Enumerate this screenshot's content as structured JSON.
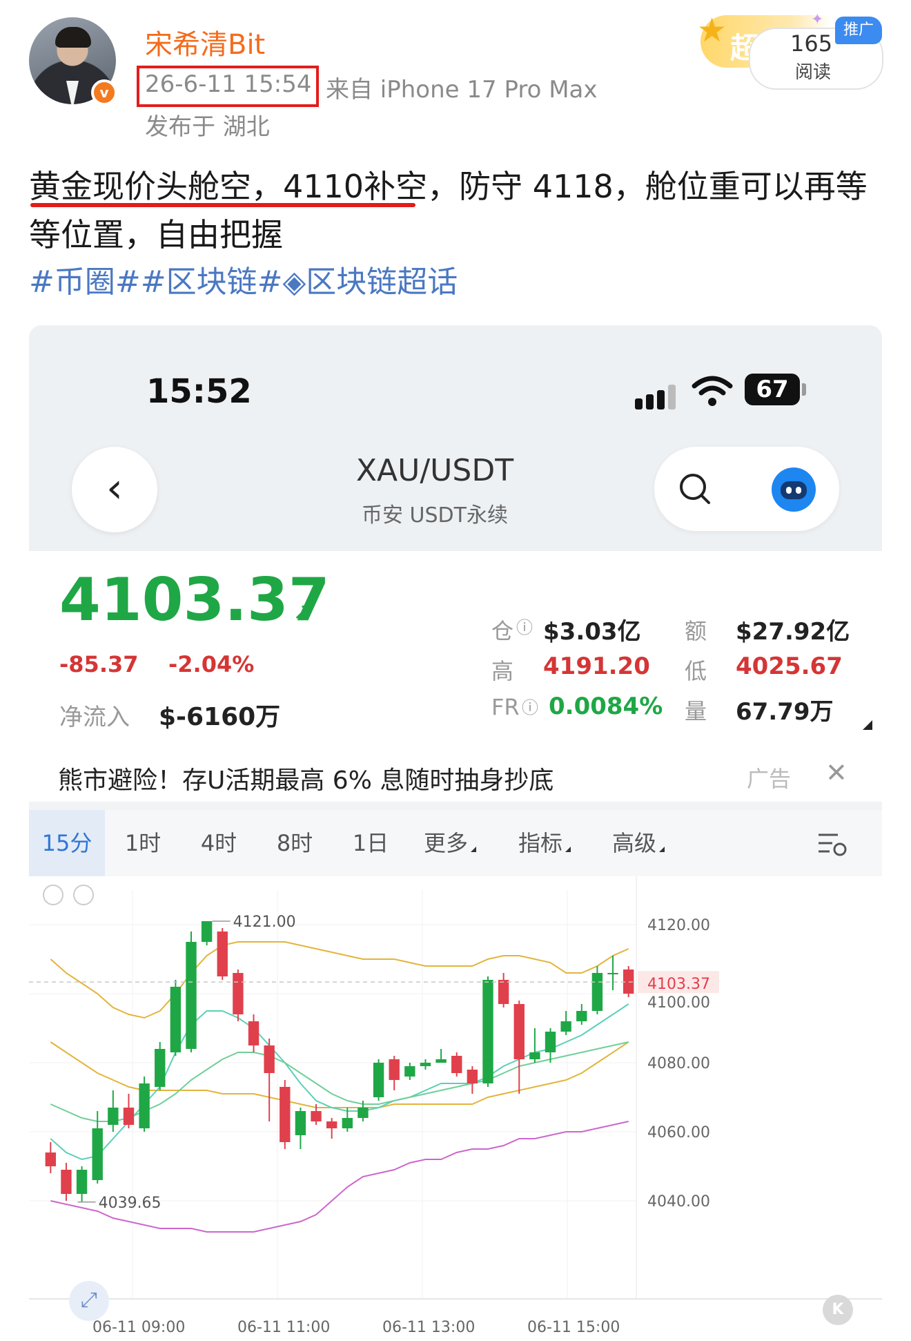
{
  "post": {
    "username": "宋希清Bit",
    "verified_mark": "v",
    "time": "26-6-11 15:54",
    "source": "来自 iPhone 17 Pro Max",
    "location": "发布于 湖北",
    "body": "黄金现价头舱空，4110补空，防守 4118，舱位重可以再等等位置，自由把握",
    "hashtags": "#币圈##区块链#◈区块链超话",
    "promo": {
      "badge": "超",
      "reads": "165",
      "reads_label": "阅读",
      "tag": "推广"
    }
  },
  "screenshot": {
    "status_bar": {
      "time": "15:52",
      "battery": "67"
    },
    "header": {
      "back_icon": "‹",
      "pair": "XAU/USDT",
      "subtitle": "币安 USDT永续"
    },
    "ticker": {
      "price": "4103.37",
      "change_abs": "-85.37",
      "change_pct": "-2.04%",
      "netflow_label": "净流入",
      "netflow": "$-6160万",
      "stats": {
        "oi_label": "仓",
        "oi": "$3.03亿",
        "turnover_label": "额",
        "turnover": "$27.92亿",
        "high_label": "高",
        "high": "4191.20",
        "low_label": "低",
        "low": "4025.67",
        "fr_label": "FR",
        "fr": "0.0084%",
        "volume_label": "量",
        "volume": "67.79万"
      }
    },
    "ad": {
      "text": "熊市避险！存U活期最高 6% 息随时抽身抄底",
      "label": "广告",
      "close": "✕"
    },
    "tabs": [
      {
        "label": "15分"
      },
      {
        "label": "1时"
      },
      {
        "label": "4时"
      },
      {
        "label": "8时"
      },
      {
        "label": "1日"
      },
      {
        "label": "更多"
      },
      {
        "label": "指标"
      },
      {
        "label": "高级"
      }
    ]
  },
  "colors": {
    "up": "#1fa746",
    "down": "#e0404c",
    "accent": "#2f76d6",
    "username": "#f46c1c",
    "hashtag": "#4a78c2"
  },
  "chart_data": {
    "type": "candlestick",
    "interval": "15分",
    "ylim": [
      4030,
      4130
    ],
    "y_ticks": [
      "4120.00",
      "4100.00",
      "4080.00",
      "4060.00",
      "4040.00"
    ],
    "x_ticks": [
      "06-11 09:00",
      "06-11 11:00",
      "06-11 13:00",
      "06-11 15:00"
    ],
    "last_price_label": "4103.37",
    "last_price": 4103.37,
    "max_label": "4121.00",
    "min_label": "4039.65",
    "candles": [
      [
        4054,
        4050,
        4057,
        4048
      ],
      [
        4049,
        4042,
        4051,
        4040
      ],
      [
        4042,
        4049,
        4050,
        4039.65
      ],
      [
        4046,
        4061,
        4066,
        4045
      ],
      [
        4062,
        4067,
        4072,
        4060
      ],
      [
        4067,
        4062,
        4071,
        4061
      ],
      [
        4061,
        4074,
        4076,
        4060
      ],
      [
        4073,
        4084,
        4086,
        4072
      ],
      [
        4083,
        4102,
        4104,
        4082
      ],
      [
        4084,
        4115,
        4118,
        4083
      ],
      [
        4115,
        4121,
        4121,
        4114
      ],
      [
        4118,
        4105,
        4119,
        4104
      ],
      [
        4106,
        4094,
        4107,
        4092
      ],
      [
        4092,
        4085,
        4094,
        4083
      ],
      [
        4085,
        4077,
        4087,
        4063
      ],
      [
        4073,
        4057,
        4075,
        4055
      ],
      [
        4059,
        4066,
        4067,
        4055
      ],
      [
        4066,
        4063,
        4068,
        4062
      ],
      [
        4063,
        4061,
        4064,
        4058
      ],
      [
        4061,
        4064,
        4067,
        4060
      ],
      [
        4064,
        4067,
        4069,
        4063
      ],
      [
        4070,
        4080,
        4081,
        4069
      ],
      [
        4081,
        4075,
        4082,
        4072
      ],
      [
        4076,
        4079,
        4080,
        4075
      ],
      [
        4079,
        4080,
        4081,
        4078
      ],
      [
        4080,
        4081,
        4084,
        4080
      ],
      [
        4082,
        4077,
        4083,
        4076
      ],
      [
        4078,
        4074,
        4079,
        4071
      ],
      [
        4074,
        4104,
        4105,
        4073
      ],
      [
        4104,
        4097,
        4106,
        4096
      ],
      [
        4097,
        4081,
        4098,
        4071
      ],
      [
        4081,
        4083,
        4090,
        4080
      ],
      [
        4083,
        4089,
        4090,
        4080
      ],
      [
        4089,
        4092,
        4095,
        4088
      ],
      [
        4092,
        4095,
        4097,
        4091
      ],
      [
        4095,
        4106,
        4108,
        4094
      ],
      [
        4106,
        4106,
        4111,
        4101
      ],
      [
        4107,
        4100,
        4108,
        4099
      ]
    ],
    "series": [
      {
        "color": "#e3b43a",
        "values": [
          4110,
          4106,
          4103,
          4100,
          4096,
          4094,
          4093,
          4095,
          4100,
          4106,
          4111,
          4114,
          4115,
          4115,
          4115,
          4115,
          4114,
          4113,
          4112,
          4111,
          4110,
          4110,
          4110,
          4109,
          4108,
          4108,
          4108,
          4108,
          4110,
          4111,
          4111,
          4110,
          4109,
          4106,
          4106,
          4108,
          4111,
          4113
        ]
      },
      {
        "color": "#e3b43a",
        "values": [
          4086,
          4083,
          4080,
          4077,
          4075,
          4073,
          4072,
          4072,
          4072,
          4072,
          4072,
          4071,
          4071,
          4071,
          4070,
          4069,
          4068,
          4067,
          4067,
          4067,
          4067,
          4067,
          4068,
          4068,
          4068,
          4068,
          4068,
          4068,
          4070,
          4071,
          4072,
          4073,
          4074,
          4075,
          4077,
          4080,
          4083,
          4086
        ]
      },
      {
        "color": "#5ad0b8",
        "values": [
          4058,
          4054,
          4052,
          4053,
          4058,
          4063,
          4068,
          4073,
          4083,
          4091,
          4095,
          4095,
          4093,
          4090,
          4085,
          4080,
          4074,
          4069,
          4067,
          4066,
          4066,
          4067,
          4069,
          4070,
          4072,
          4074,
          4074,
          4074,
          4076,
          4079,
          4081,
          4083,
          4084,
          4086,
          4088,
          4091,
          4094,
          4097
        ]
      },
      {
        "color": "#6fcf97",
        "values": [
          4068,
          4066,
          4064,
          4063,
          4063,
          4064,
          4066,
          4068,
          4071,
          4075,
          4078,
          4081,
          4083,
          4083,
          4082,
          4080,
          4077,
          4074,
          4071,
          4069,
          4068,
          4068,
          4069,
          4070,
          4071,
          4072,
          4073,
          4074,
          4075,
          4077,
          4079,
          4080,
          4081,
          4082,
          4083,
          4084,
          4085,
          4086
        ]
      },
      {
        "color": "#cc66cc",
        "values": [
          4040,
          4039,
          4038,
          4037,
          4035,
          4034,
          4033,
          4032,
          4032,
          4032,
          4031,
          4031,
          4031,
          4031,
          4032,
          4033,
          4034,
          4036,
          4040,
          4044,
          4047,
          4048,
          4049,
          4051,
          4052,
          4052,
          4054,
          4055,
          4055,
          4056,
          4058,
          4058,
          4059,
          4060,
          4060,
          4061,
          4062,
          4063
        ]
      }
    ]
  }
}
